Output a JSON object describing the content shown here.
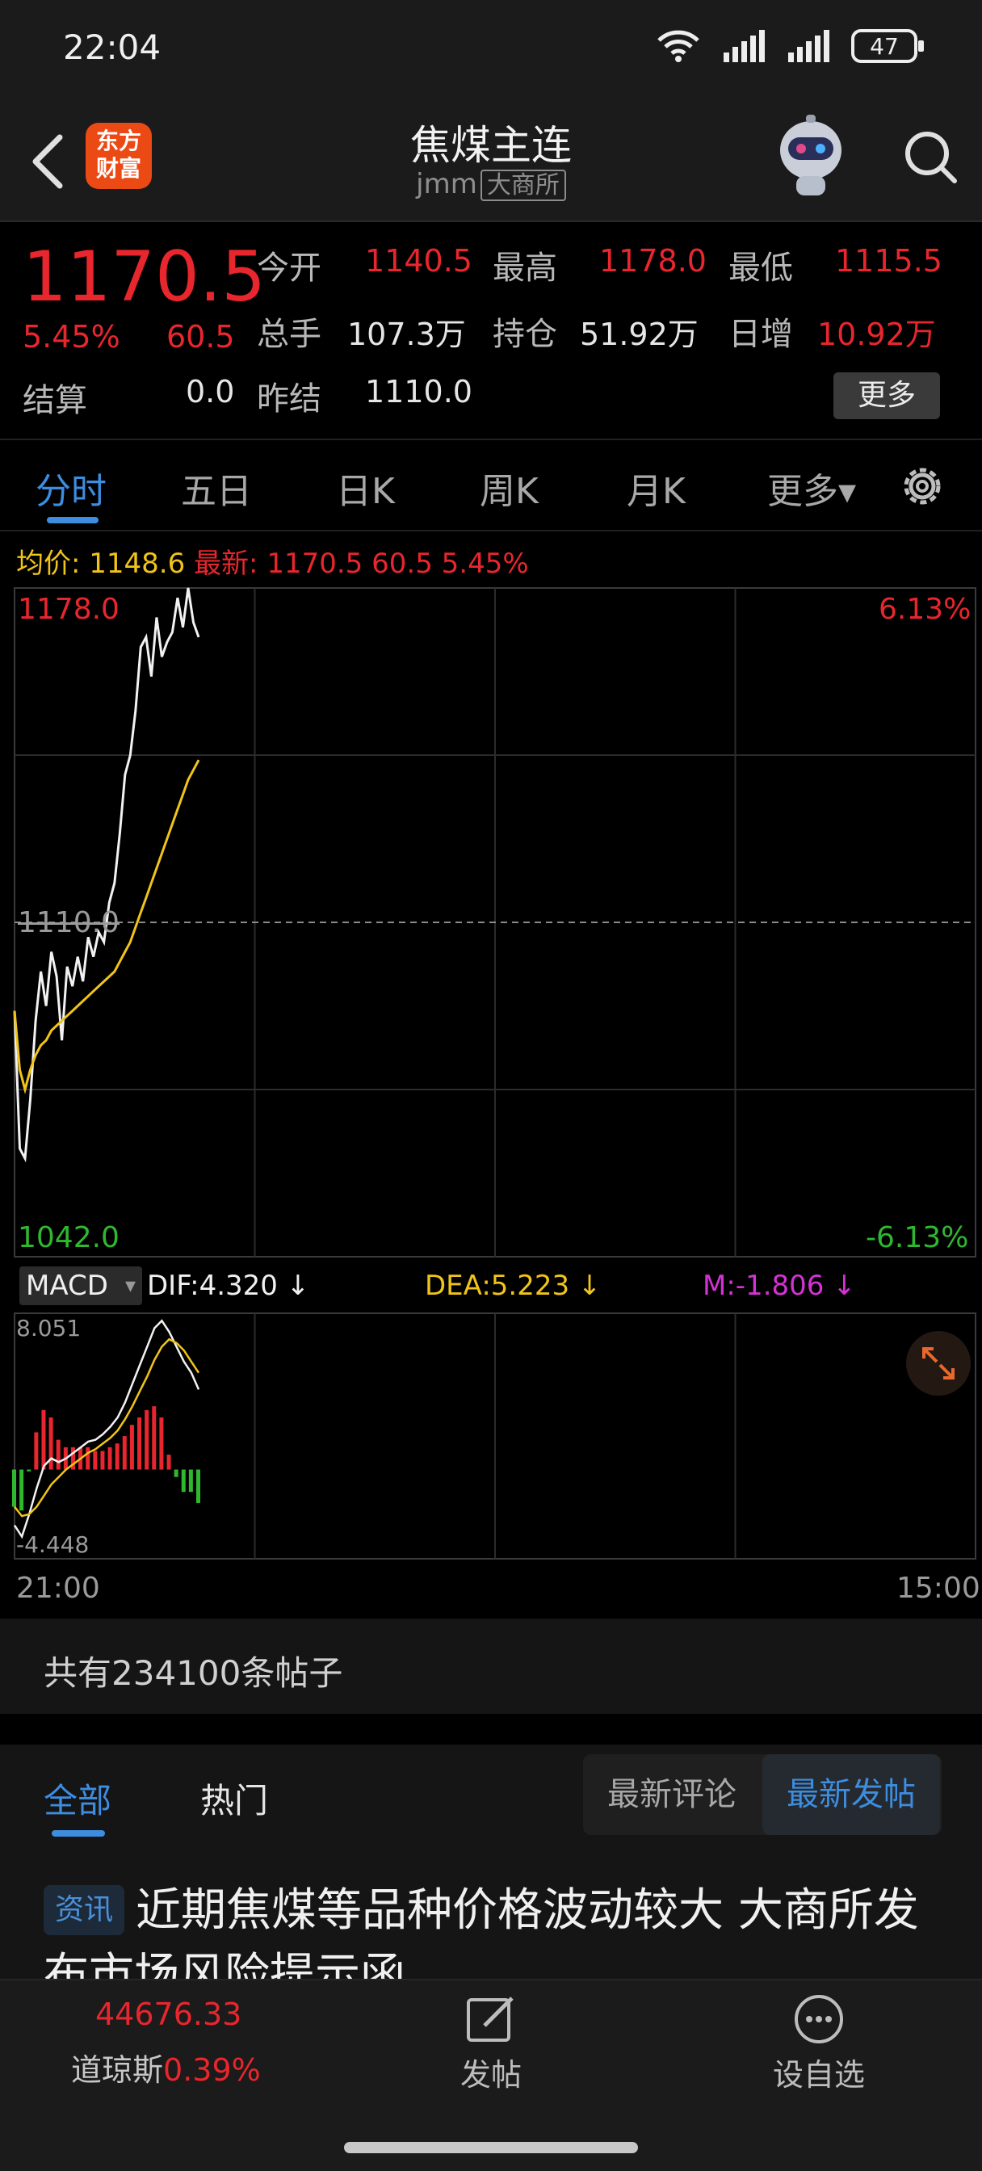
{
  "status_bar": {
    "time": "22:04",
    "battery": "47"
  },
  "header": {
    "title": "焦煤主连",
    "code": "jmm",
    "exchange": "大商所",
    "logo_text": "东方财富"
  },
  "quote": {
    "price": "1170.5",
    "change_pct": "5.45%",
    "change": "60.5",
    "settle_label": "结算",
    "settle_value": "0.0",
    "prev_settle_label": "昨结",
    "prev_settle_value": "1110.0",
    "open_label": "今开",
    "open_value": "1140.5",
    "high_label": "最高",
    "high_value": "1178.0",
    "low_label": "最低",
    "low_value": "1115.5",
    "volume_label": "总手",
    "volume_value": "107.3万",
    "oi_label": "持仓",
    "oi_value": "51.92万",
    "daily_inc_label": "日增",
    "daily_inc_value": "10.92万",
    "more_button": "更多"
  },
  "chart_tabs": [
    "分时",
    "五日",
    "日K",
    "周K",
    "月K",
    "更多▾"
  ],
  "chart_legend": {
    "avg_label": "均价:",
    "avg_value": "1148.6",
    "latest_label": "最新:",
    "latest_value": "1170.5 60.5 5.45%"
  },
  "chart_labels": {
    "top_price": "1178.0",
    "mid_price": "1110.0",
    "bottom_price": "1042.0",
    "top_pct": "6.13%",
    "bottom_pct": "-6.13%",
    "macd_top": "8.051",
    "macd_bottom": "-4.448",
    "time_start": "21:00",
    "time_end": "15:00"
  },
  "macd": {
    "selector": "MACD",
    "dif": "DIF:4.320 ↓",
    "dea": "DEA:5.223 ↓",
    "m": "M:-1.806 ↓"
  },
  "colors": {
    "up": "#e8262d",
    "down": "#2fb82f",
    "accent": "#3d8de0",
    "avg": "#f0c419",
    "macd_m": "#d432d4"
  },
  "chart_data": {
    "type": "line",
    "title": "",
    "ylim": [
      1042.0,
      1178.0
    ],
    "reference": 1110.0,
    "x_start": "21:00",
    "x_end": "15:00",
    "series": [
      {
        "name": "最新",
        "values": [
          1092,
          1064,
          1062,
          1074,
          1090,
          1100,
          1093,
          1104,
          1099,
          1086,
          1101,
          1097,
          1103,
          1098,
          1107,
          1103,
          1108,
          1106,
          1114,
          1118,
          1128,
          1140,
          1144,
          1153,
          1166,
          1168,
          1160,
          1172,
          1164,
          1167,
          1169,
          1176,
          1170,
          1178,
          1171,
          1168
        ]
      },
      {
        "name": "均价",
        "values": [
          1092,
          1080,
          1076,
          1080,
          1083,
          1085,
          1086,
          1088,
          1089,
          1090,
          1091,
          1092,
          1093,
          1094,
          1095,
          1096,
          1097,
          1098,
          1099,
          1100,
          1102,
          1104,
          1106,
          1109,
          1112,
          1115,
          1118,
          1121,
          1124,
          1127,
          1130,
          1133,
          1136,
          1139,
          1141,
          1143
        ]
      }
    ],
    "macd": {
      "ylim": [
        -4.448,
        8.051
      ],
      "dif": [
        -3.0,
        -3.6,
        -2.4,
        -1.0,
        0.2,
        0.6,
        0.4,
        0.6,
        0.9,
        1.2,
        1.5,
        1.6,
        1.9,
        2.3,
        2.8,
        3.6,
        4.6,
        5.6,
        6.6,
        7.6,
        8.0,
        7.4,
        6.6,
        5.8,
        5.2,
        4.3
      ],
      "dea": [
        -2.0,
        -2.5,
        -2.4,
        -2.0,
        -1.4,
        -0.8,
        -0.4,
        0.0,
        0.3,
        0.6,
        0.9,
        1.1,
        1.4,
        1.7,
        2.1,
        2.7,
        3.4,
        4.2,
        5.0,
        5.9,
        6.6,
        7.0,
        6.8,
        6.4,
        5.8,
        5.2
      ],
      "m": [
        -2.0,
        -2.2,
        -0.1,
        2.0,
        3.2,
        2.8,
        1.6,
        1.2,
        1.2,
        1.2,
        1.2,
        1.0,
        1.0,
        1.2,
        1.4,
        1.8,
        2.4,
        2.8,
        3.2,
        3.4,
        2.8,
        0.8,
        -0.4,
        -1.2,
        -1.2,
        -1.8
      ]
    }
  },
  "posts": {
    "count_text": "共有234100条帖子"
  },
  "feed": {
    "tabs": [
      "全部",
      "热门"
    ],
    "sort_options": [
      "最新评论",
      "最新发帖"
    ],
    "news_badge": "资讯",
    "news_title": "近期焦煤等品种价格波动较大 大商所发布市场风险提示函"
  },
  "bottom_bar": {
    "index_value": "44676.33",
    "index_name": "道琼斯",
    "index_pct": "0.39%",
    "post_label": "发帖",
    "watch_label": "设自选"
  }
}
